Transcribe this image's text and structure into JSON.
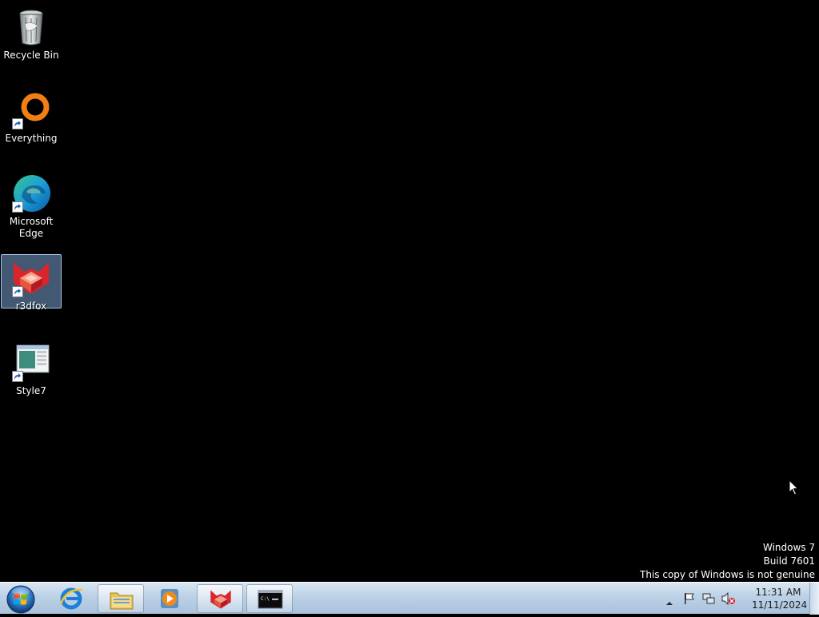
{
  "desktop": {
    "icons": [
      {
        "label": "Recycle Bin",
        "icon": "recycle-bin-icon"
      },
      {
        "label": "Everything",
        "icon": "everything-icon",
        "shortcut": true
      },
      {
        "label": "Microsoft\nEdge",
        "icon": "edge-icon",
        "shortcut": true
      },
      {
        "label": "r3dfox",
        "icon": "r3dfox-icon",
        "shortcut": true,
        "selected": true
      },
      {
        "label": "Style7",
        "icon": "style7-icon",
        "shortcut": true
      }
    ]
  },
  "watermark": {
    "line1": "Windows 7",
    "line2": "Build 7601",
    "line3": "This copy of Windows is not genuine"
  },
  "taskbar": {
    "start_icon": "windows-start-orb-icon",
    "buttons": [
      {
        "icon": "internet-explorer-icon",
        "active": false
      },
      {
        "icon": "file-explorer-icon",
        "active": true
      },
      {
        "icon": "media-player-icon",
        "active": false
      },
      {
        "icon": "r3dfox-icon",
        "active": true
      },
      {
        "icon": "command-prompt-icon",
        "active": true
      }
    ],
    "tray": {
      "icons": [
        "show-hidden-icons-arrow-icon",
        "action-center-flag-icon",
        "network-icon",
        "volume-muted-icon"
      ]
    },
    "clock": {
      "time": "11:31 AM",
      "date": "11/11/2024"
    }
  },
  "colors": {
    "desktop_background": "#000000",
    "taskbar": "#bcd1e6",
    "selection": "#78a0d2"
  }
}
